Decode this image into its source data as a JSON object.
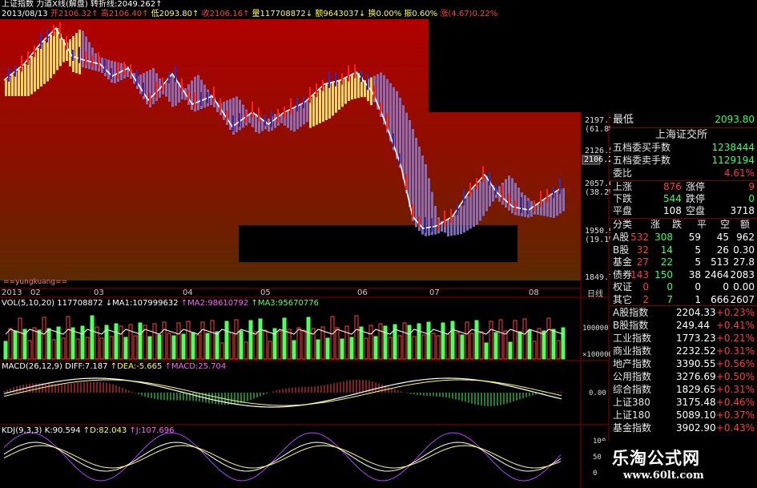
{
  "header": {
    "line1": "上证指数  力道X线(解盘)  转折线:2049.262↑",
    "line2_date": "2013/08/13",
    "line2_open": "开2106.32↑",
    "line2_high": "高2106.40↑",
    "line2_low": "低2093.80↑",
    "line2_close": "收2106.16↑",
    "line2_vol": "量117708872↓",
    "line2_amt": "额9643037↓",
    "line2_chg": "换0.00%",
    "line2_amp": "振0.60%",
    "line2_up": "涨(4.67)0.22%"
  },
  "main_axis": {
    "ticks": [
      "2197.7",
      "(61.8%)",
      "2126.5",
      "2106.2",
      "2057.6",
      "(38.2%)",
      "1950.9",
      "(19.1%)",
      "1849.7"
    ],
    "current_price": "2106.2"
  },
  "date_axis": [
    "2013",
    "02",
    "03",
    "04",
    "05",
    "06",
    "07",
    "08"
  ],
  "date_axis_right": "日线",
  "watermark_label": "==yungkuang==",
  "volume": {
    "title": "VOL(5,10,20)",
    "vol": "117708872",
    "ma1": "↓MA1:107999632",
    "ma2": "↑MA2:98610792",
    "ma3": "↑MA3:95670776",
    "tick1": "100000",
    "tick2": "×100000"
  },
  "macd": {
    "title": "MACD(26,12,9)",
    "diff": "DIFF:7.187",
    "dea": "↑DEA:-5.665",
    "macd": "↑MACD:25.704",
    "tick": "0.00"
  },
  "kdj": {
    "title": "KDJ(9,3,3)",
    "k": "K:90.594",
    "d": "↑D:82.043",
    "j": "↑J:107.696",
    "ticks": [
      "100",
      "50",
      "0"
    ]
  },
  "right_panel": {
    "lowest_label": "最低",
    "lowest_value": "2093.80",
    "exchange": "上海证交所",
    "buy_label": "五档委买手数",
    "buy_value": "1238444",
    "sell_label": "五档委卖手数",
    "sell_value": "1129194",
    "ratio_label": "委比",
    "ratio_value": "4.61%",
    "up_label": "上涨",
    "up_value": "876",
    "limitup_label": "涨停",
    "limitup_value": "9",
    "down_label": "下跌",
    "down_value": "544",
    "limitdown_label": "跌停",
    "limitdown_value": "0",
    "flat_label": "平盘",
    "flat_value": "108",
    "empty_label": "空盘",
    "empty_value": "3718",
    "table_headers": [
      "分类",
      "涨",
      "跌",
      "平",
      "空",
      "额"
    ],
    "table_rows": [
      {
        "name": "A股",
        "up": "532",
        "down": "308",
        "flat": "59",
        "empty": "45",
        "amt": "962"
      },
      {
        "name": "B股",
        "up": "32",
        "down": "14",
        "flat": "5",
        "empty": "26",
        "amt": "0.30"
      },
      {
        "name": "基金",
        "up": "27",
        "down": "22",
        "flat": "5",
        "empty": "513",
        "amt": "27.8"
      },
      {
        "name": "债券",
        "up": "143",
        "down": "150",
        "flat": "38",
        "empty": "2464",
        "amt": "2083"
      },
      {
        "name": "权证",
        "up": "0",
        "down": "0",
        "flat": "0",
        "empty": "0",
        "amt": "0.00"
      },
      {
        "name": "其它",
        "up": "2",
        "down": "7",
        "flat": "1",
        "empty": "666",
        "amt": "2607"
      }
    ],
    "indices": [
      {
        "name": "A股指数",
        "value": "2204.33",
        "change": "+0.23%"
      },
      {
        "name": "B股指数",
        "value": "249.44",
        "change": "+0.41%"
      },
      {
        "name": "工业指数",
        "value": "1773.23",
        "change": "+0.21%"
      },
      {
        "name": "商业指数",
        "value": "2232.52",
        "change": "+0.31%"
      },
      {
        "name": "地产指数",
        "value": "3390.55",
        "change": "+0.56%"
      },
      {
        "name": "公用指数",
        "value": "3276.69",
        "change": "+0.50%"
      },
      {
        "name": "综合指数",
        "value": "1829.65",
        "change": "+0.31%"
      },
      {
        "name": "上证380",
        "value": "3175.48",
        "change": "+0.46%"
      },
      {
        "name": "上证180",
        "value": "5089.10",
        "change": "+0.37%"
      },
      {
        "name": "基金指数",
        "value": "3902.90",
        "change": "+0.43%"
      }
    ]
  },
  "logo": {
    "text": "乐淘公式网",
    "url": "www.60lt.com"
  }
}
